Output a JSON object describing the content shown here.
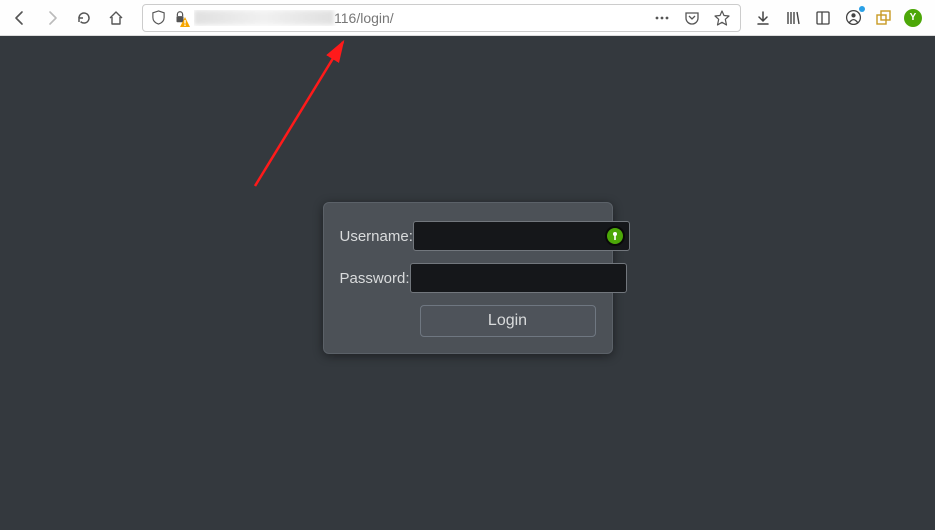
{
  "toolbar": {
    "url_visible": "116/login/",
    "icons": {
      "back": "back-icon",
      "forward": "forward-icon",
      "reload": "reload-icon",
      "home": "home-icon",
      "shield": "shield-icon",
      "lock_warn": "lock-warning-icon",
      "more": "more-icon",
      "pocket": "pocket-icon",
      "star": "star-icon",
      "download": "download-icon",
      "library": "library-icon",
      "reader": "reader-icon",
      "account": "account-icon",
      "ext1": "extension-icon",
      "ext2": "passman-icon"
    }
  },
  "login": {
    "username_label": "Username:",
    "password_label": "Password:",
    "username_value": "",
    "password_value": "",
    "submit_label": "Login"
  },
  "annotation": {
    "arrow_color": "#ff1a1a"
  }
}
